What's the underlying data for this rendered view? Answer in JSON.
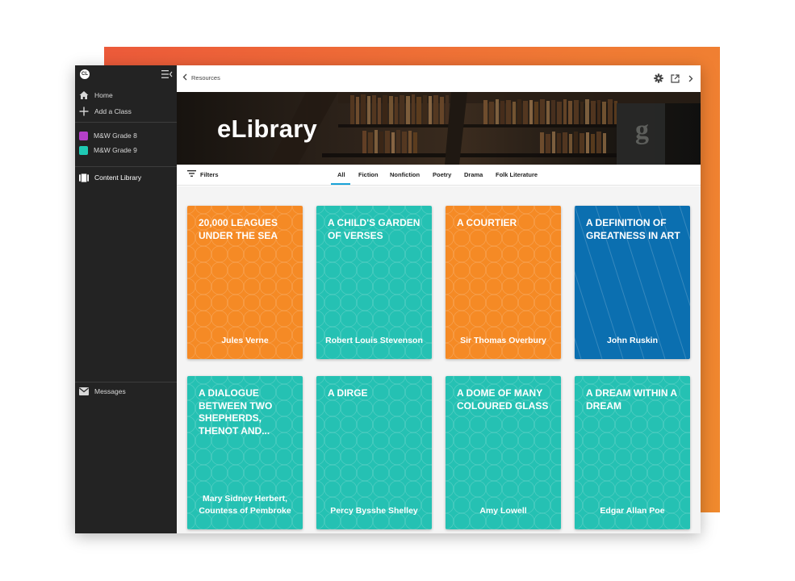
{
  "sidebar": {
    "logo": "CL",
    "items": [
      {
        "label": "Home",
        "icon": "home-icon"
      },
      {
        "label": "Add a Class",
        "icon": "plus-icon"
      }
    ],
    "classes": [
      {
        "label": "M&W Grade 8",
        "color": "#b540c8"
      },
      {
        "label": "M&W Grade 9",
        "color": "#1fc9b4"
      }
    ],
    "content_library": "Content Library",
    "messages": "Messages"
  },
  "topbar": {
    "back_label": "Resources"
  },
  "hero": {
    "title": "eLibrary"
  },
  "filterbar": {
    "filters_label": "Filters",
    "tabs": [
      "All",
      "Fiction",
      "Nonfiction",
      "Poetry",
      "Drama",
      "Folk Literature"
    ],
    "active_tab": "All"
  },
  "colors": {
    "orange": "#f58a25",
    "teal": "#25c1b3",
    "blue": "#0b6fb0",
    "accent": "#1aa3d8"
  },
  "books": [
    {
      "title": "20,000 Leagues Under the Sea",
      "author": "Jules Verne",
      "color": "orange"
    },
    {
      "title": "A Child's Garden of Verses",
      "author": "Robert Louis Stevenson",
      "color": "teal"
    },
    {
      "title": "A Courtier",
      "author": "Sir Thomas Overbury",
      "color": "orange"
    },
    {
      "title": "A Definition of Greatness in Art",
      "author": "John Ruskin",
      "color": "blue"
    },
    {
      "title": "A Dialogue Between Two Shepherds, Thenot and...",
      "author": "Mary Sidney Herbert, Countess of Pembroke",
      "color": "teal"
    },
    {
      "title": "A Dirge",
      "author": "Percy Bysshe Shelley",
      "color": "teal"
    },
    {
      "title": "A Dome of Many Coloured Glass",
      "author": "Amy Lowell",
      "color": "teal"
    },
    {
      "title": "A Dream Within a Dream",
      "author": "Edgar Allan Poe",
      "color": "teal"
    }
  ]
}
